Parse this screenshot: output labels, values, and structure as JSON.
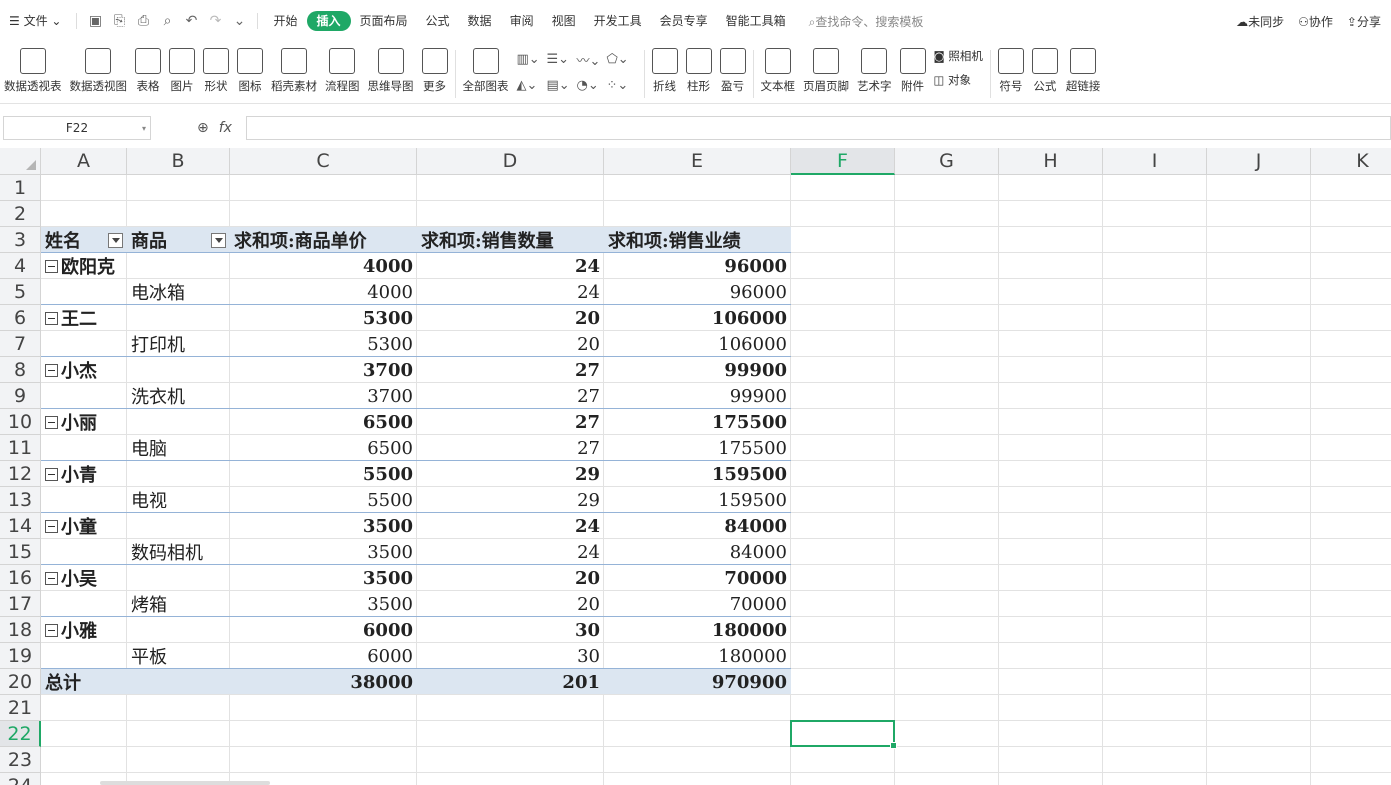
{
  "menubar": {
    "file_label": "文件",
    "tabs": [
      "开始",
      "插入",
      "页面布局",
      "公式",
      "数据",
      "审阅",
      "视图",
      "开发工具",
      "会员专享",
      "智能工具箱"
    ],
    "active_tab": "插入",
    "search_placeholder": "查找命令、搜索模板",
    "right": {
      "sync": "未同步",
      "collab": "协作",
      "share": "分享"
    }
  },
  "ribbon": {
    "buttons_left": [
      "数据透视表",
      "数据透视图",
      "表格",
      "图片",
      "形状",
      "图标",
      "稻壳素材",
      "流程图",
      "思维导图",
      "更多"
    ],
    "all_charts": "全部图表",
    "sparklines": [
      "折线",
      "柱形",
      "盈亏"
    ],
    "buttons_right": [
      "文本框",
      "页眉页脚",
      "艺术字",
      "附件"
    ],
    "small": {
      "camera": "照相机",
      "object": "对象"
    },
    "buttons_far": [
      "符号",
      "公式",
      "超链接"
    ]
  },
  "formula": {
    "cell_ref": "F22",
    "fx": "fx",
    "value": ""
  },
  "columns": [
    "A",
    "B",
    "C",
    "D",
    "E",
    "F",
    "G",
    "H",
    "I",
    "J",
    "K"
  ],
  "selected_column": "F",
  "rows": [
    "1",
    "2",
    "3",
    "4",
    "5",
    "6",
    "7",
    "8",
    "9",
    "10",
    "11",
    "12",
    "13",
    "14",
    "15",
    "16",
    "17",
    "18",
    "19",
    "20",
    "21",
    "22",
    "23",
    "24"
  ],
  "selected_row": "22",
  "pivot": {
    "headers": [
      "姓名",
      "商品",
      "求和项:商品单价",
      "求和项:销售数量",
      "求和项:销售业绩"
    ],
    "groups": [
      {
        "name": "欧阳克",
        "product": "电冰箱",
        "price": "4000",
        "qty": "24",
        "total": "96000"
      },
      {
        "name": "王二",
        "product": "打印机",
        "price": "5300",
        "qty": "20",
        "total": "106000"
      },
      {
        "name": "小杰",
        "product": "洗衣机",
        "price": "3700",
        "qty": "27",
        "total": "99900"
      },
      {
        "name": "小丽",
        "product": "电脑",
        "price": "6500",
        "qty": "27",
        "total": "175500"
      },
      {
        "name": "小青",
        "product": "电视",
        "price": "5500",
        "qty": "29",
        "total": "159500"
      },
      {
        "name": "小童",
        "product": "数码相机",
        "price": "3500",
        "qty": "24",
        "total": "84000"
      },
      {
        "name": "小吴",
        "product": "烤箱",
        "price": "3500",
        "qty": "20",
        "total": "70000"
      },
      {
        "name": "小雅",
        "product": "平板",
        "price": "6000",
        "qty": "30",
        "total": "180000"
      }
    ],
    "grand_total": {
      "label": "总计",
      "price": "38000",
      "qty": "201",
      "total": "970900"
    }
  }
}
